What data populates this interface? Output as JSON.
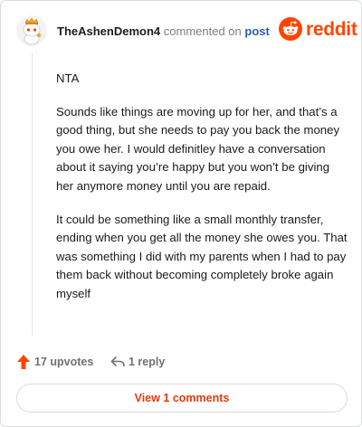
{
  "comment": {
    "username": "TheAshenDemon4",
    "action_text": "commented on",
    "post_link": "post",
    "paragraphs": [
      "NTA",
      "Sounds like things are moving up for her, and that’s a good thing, but she needs to pay you back the money you owe her. I would definitley have a conversation about it saying you’re happy but you won’t be giving her anymore money until you are repaid.",
      "It could be something like a small monthly transfer, ending when you get all the money she owes you. That was something I did with my parents when I had to pay them back without becoming completely broke again myself"
    ],
    "upvotes_label": "17 upvotes",
    "reply_label": "1 reply"
  },
  "brand": {
    "wordmark": "reddit",
    "icon": "reddit-snoo-icon"
  },
  "footer": {
    "view_comments_label": "View 1 comments"
  },
  "colors": {
    "accent": "#ff4500",
    "link": "#2a5db0",
    "muted": "#7c7c83"
  }
}
